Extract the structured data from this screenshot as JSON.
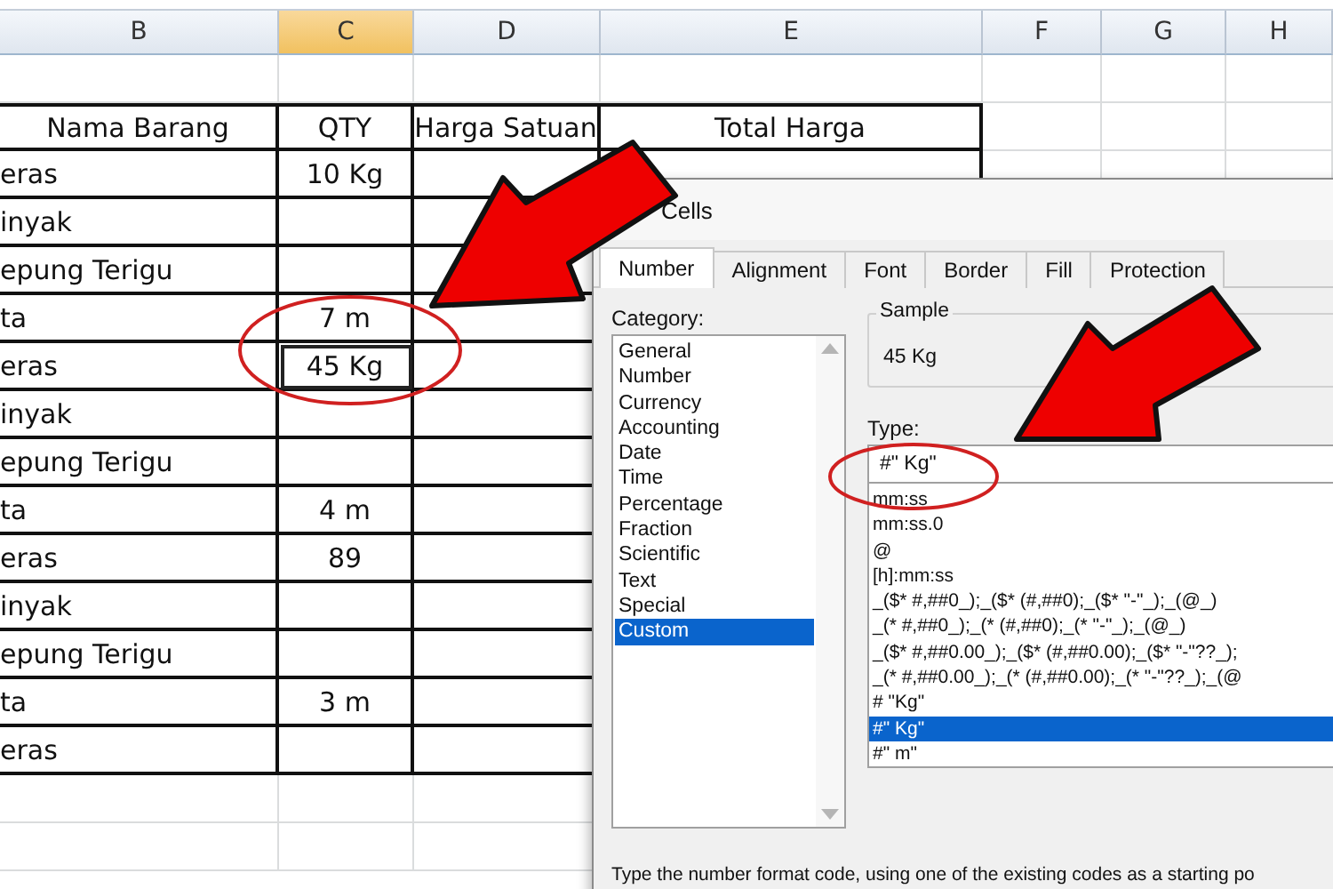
{
  "sheet": {
    "columns": [
      {
        "label": "B",
        "selected": false
      },
      {
        "label": "C",
        "selected": true
      },
      {
        "label": "D",
        "selected": false
      },
      {
        "label": "E",
        "selected": false
      },
      {
        "label": "F",
        "selected": false
      },
      {
        "label": "G",
        "selected": false
      },
      {
        "label": "H",
        "selected": false
      }
    ],
    "header": [
      "Nama Barang",
      "QTY",
      "Harga Satuan",
      "Total Harga"
    ],
    "rows": [
      {
        "name": "eras",
        "qty": "10 Kg",
        "selected": false
      },
      {
        "name": "inyak",
        "selected": false
      },
      {
        "name": "epung Terigu",
        "selected": false
      },
      {
        "name": "ta",
        "qty": "7 m",
        "selected": false
      },
      {
        "name": "eras",
        "qty": "45 Kg",
        "selected": true
      },
      {
        "name": "inyak",
        "selected": false
      },
      {
        "name": "epung Terigu",
        "selected": false
      },
      {
        "name": "ta",
        "qty": "4 m",
        "selected": false
      },
      {
        "name": "eras",
        "qty": "89",
        "selected": false
      },
      {
        "name": "inyak",
        "selected": false
      },
      {
        "name": "epung Terigu",
        "selected": false
      },
      {
        "name": "ta",
        "qty": "3 m",
        "selected": false
      },
      {
        "name": "eras",
        "selected": false
      }
    ]
  },
  "dialog": {
    "title": "Cells",
    "tabs": [
      {
        "label": "Number",
        "selected": true
      },
      {
        "label": "Alignment",
        "selected": false
      },
      {
        "label": "Font",
        "selected": false
      },
      {
        "label": "Border",
        "selected": false
      },
      {
        "label": "Fill",
        "selected": false
      },
      {
        "label": "Protection",
        "selected": false
      }
    ],
    "category_label": "Category:",
    "categories": [
      {
        "label": "General",
        "selected": false
      },
      {
        "label": "Number",
        "selected": false
      },
      {
        "label": "Currency",
        "selected": false
      },
      {
        "label": "Accounting",
        "selected": false
      },
      {
        "label": "Date",
        "selected": false
      },
      {
        "label": "Time",
        "selected": false
      },
      {
        "label": "Percentage",
        "selected": false
      },
      {
        "label": "Fraction",
        "selected": false
      },
      {
        "label": "Scientific",
        "selected": false
      },
      {
        "label": "Text",
        "selected": false
      },
      {
        "label": "Special",
        "selected": false
      },
      {
        "label": "Custom",
        "selected": true
      }
    ],
    "sample_label": "Sample",
    "sample_value": "45 Kg",
    "type_label": "Type:",
    "type_value": "#\" Kg\"",
    "formats": [
      {
        "label": "mm:ss",
        "selected": false
      },
      {
        "label": "mm:ss.0",
        "selected": false
      },
      {
        "label": "@",
        "selected": false
      },
      {
        "label": "[h]:mm:ss",
        "selected": false
      },
      {
        "label": "_($* #,##0_);_($* (#,##0);_($* \"-\"_);_(@_)",
        "selected": false
      },
      {
        "label": "_(* #,##0_);_(* (#,##0);_(* \"-\"_);_(@_)",
        "selected": false
      },
      {
        "label": "_($* #,##0.00_);_($* (#,##0.00);_($* \"-\"??_);",
        "selected": false
      },
      {
        "label": "_(* #,##0.00_);_(* (#,##0.00);_(* \"-\"??_);_(@",
        "selected": false
      },
      {
        "label": "# \"Kg\"",
        "selected": false
      },
      {
        "label": "#\" Kg\"",
        "selected": true
      },
      {
        "label": "#\" m\"",
        "selected": false
      }
    ],
    "description": "Type the number format code, using one of the existing codes as a starting po"
  }
}
